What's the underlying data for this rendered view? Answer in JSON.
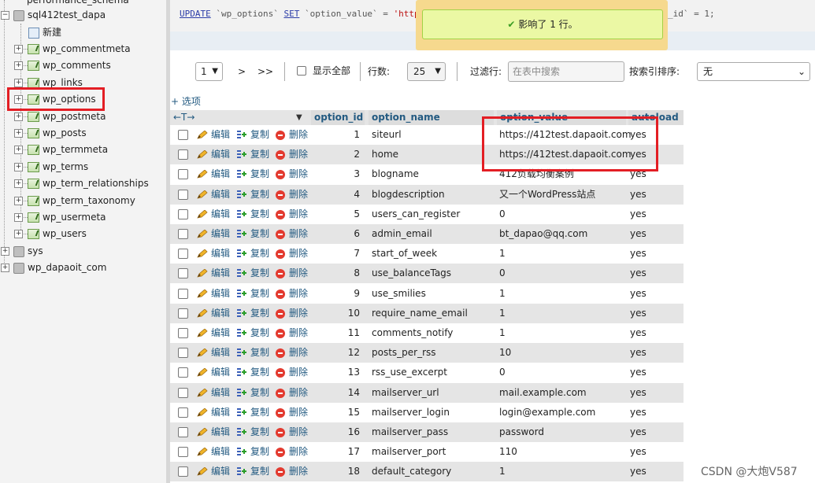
{
  "sidebar": {
    "top_partial": "performance_schema",
    "db_name": "sql412test_dapa",
    "new_label": "新建",
    "tables": [
      "wp_commentmeta",
      "wp_comments",
      "wp_links",
      "wp_options",
      "wp_postmeta",
      "wp_posts",
      "wp_termmeta",
      "wp_terms",
      "wp_term_relationships",
      "wp_term_taxonomy",
      "wp_usermeta",
      "wp_users"
    ],
    "other_dbs": [
      "sys",
      "wp_dapaoit_com"
    ]
  },
  "sql": {
    "p1": "UPDATE",
    "p2": " `wp_options` ",
    "p3": "SET",
    "p4": " `option_value` = ",
    "p5": "'https",
    "tail": "_id` = 1;"
  },
  "toast": {
    "message": "影响了 1 行。"
  },
  "nav": {
    "page_value": "1",
    "next": ">",
    "last": ">>",
    "show_all": "显示全部",
    "rows_label": "行数:",
    "rows_value": "25",
    "filter_label": "过滤行:",
    "filter_placeholder": "在表中搜索",
    "sort_label": "按索引排序:",
    "sort_value": "无"
  },
  "options_link": "+ 选项",
  "columns": {
    "arrows": "←T→",
    "option_id": "option_id",
    "option_name": "option_name",
    "option_value": "option_value",
    "autoload": "autoload"
  },
  "actions": {
    "edit": "编辑",
    "copy": "复制",
    "delete": "删除"
  },
  "rows": [
    {
      "id": "1",
      "name": "siteurl",
      "value": "https://412test.dapaoit.com",
      "autoload": "yes"
    },
    {
      "id": "2",
      "name": "home",
      "value": "https://412test.dapaoit.com",
      "autoload": "yes"
    },
    {
      "id": "3",
      "name": "blogname",
      "value": "412负载均衡案例",
      "autoload": "yes"
    },
    {
      "id": "4",
      "name": "blogdescription",
      "value": "又一个WordPress站点",
      "autoload": "yes"
    },
    {
      "id": "5",
      "name": "users_can_register",
      "value": "0",
      "autoload": "yes"
    },
    {
      "id": "6",
      "name": "admin_email",
      "value": "bt_dapao@qq.com",
      "autoload": "yes"
    },
    {
      "id": "7",
      "name": "start_of_week",
      "value": "1",
      "autoload": "yes"
    },
    {
      "id": "8",
      "name": "use_balanceTags",
      "value": "0",
      "autoload": "yes"
    },
    {
      "id": "9",
      "name": "use_smilies",
      "value": "1",
      "autoload": "yes"
    },
    {
      "id": "10",
      "name": "require_name_email",
      "value": "1",
      "autoload": "yes"
    },
    {
      "id": "11",
      "name": "comments_notify",
      "value": "1",
      "autoload": "yes"
    },
    {
      "id": "12",
      "name": "posts_per_rss",
      "value": "10",
      "autoload": "yes"
    },
    {
      "id": "13",
      "name": "rss_use_excerpt",
      "value": "0",
      "autoload": "yes"
    },
    {
      "id": "14",
      "name": "mailserver_url",
      "value": "mail.example.com",
      "autoload": "yes"
    },
    {
      "id": "15",
      "name": "mailserver_login",
      "value": "login@example.com",
      "autoload": "yes"
    },
    {
      "id": "16",
      "name": "mailserver_pass",
      "value": "password",
      "autoload": "yes"
    },
    {
      "id": "17",
      "name": "mailserver_port",
      "value": "110",
      "autoload": "yes"
    },
    {
      "id": "18",
      "name": "default_category",
      "value": "1",
      "autoload": "yes"
    }
  ],
  "watermark": "CSDN @大炮V587",
  "colors": {
    "highlight": "#e31e24",
    "link": "#235a81",
    "toast_bg": "#ebf8a4",
    "toast_border": "#f6d98e"
  }
}
